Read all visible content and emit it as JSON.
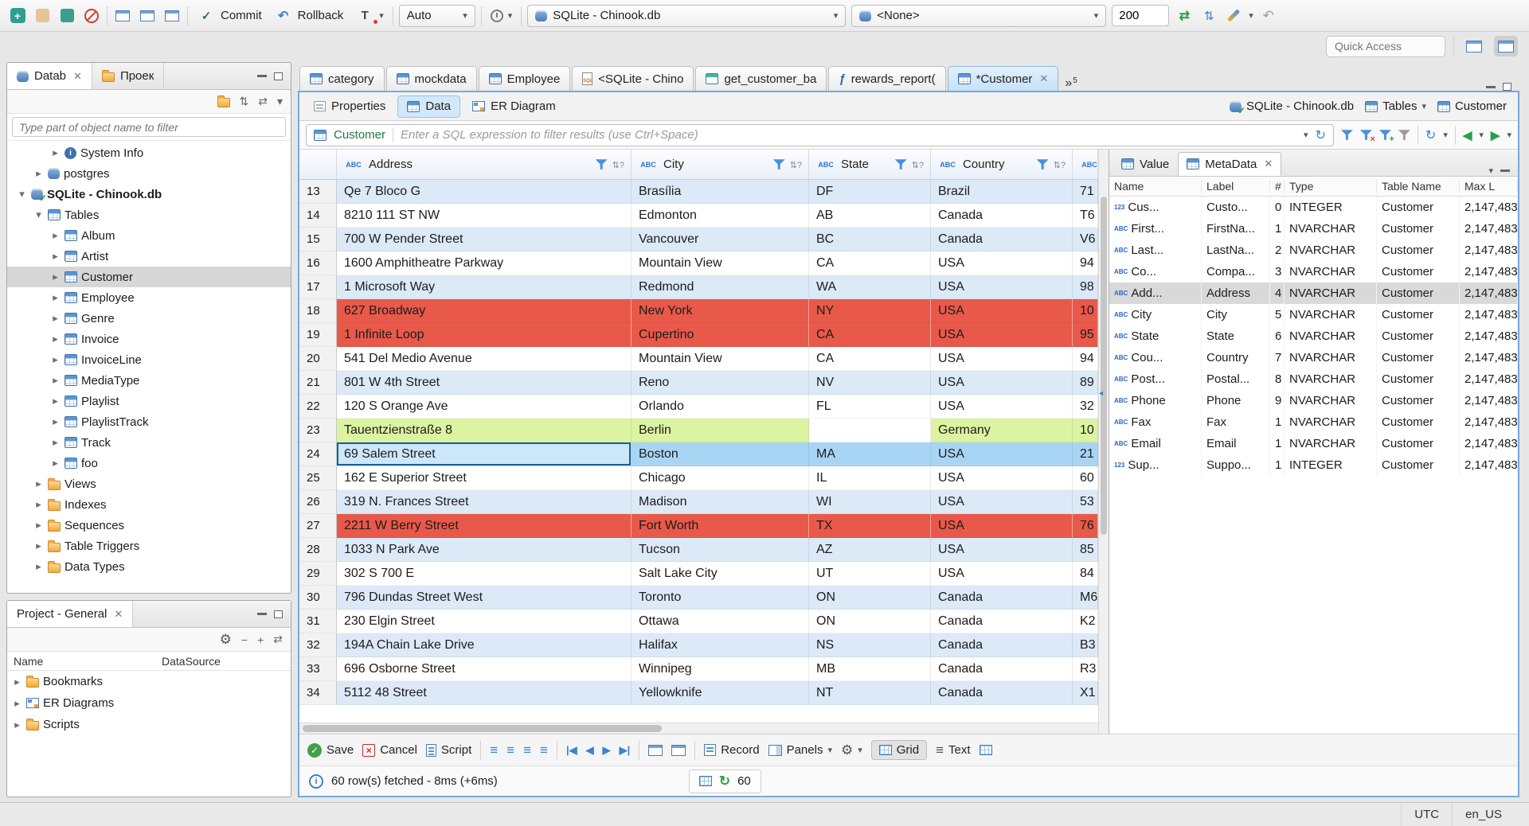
{
  "toolbar": {
    "commit_label": "Commit",
    "rollback_label": "Rollback",
    "auto_label": "Auto",
    "connection": "SQLite - Chinook.db",
    "schema": "<None>",
    "fetch_size": "200",
    "quick_access_placeholder": "Quick Access"
  },
  "navigator": {
    "tab_database": "Datab",
    "tab_project": "Проек",
    "filter_placeholder": "Type part of object name to filter",
    "tree": [
      {
        "label": "System Info",
        "depth": 2,
        "state": "collapsed",
        "icon": "info"
      },
      {
        "label": "postgres",
        "depth": 1,
        "state": "collapsed",
        "icon": "db"
      },
      {
        "label": "SQLite - Chinook.db",
        "depth": 0,
        "state": "expanded",
        "icon": "dbcheck",
        "bold": "bold"
      },
      {
        "label": "Tables",
        "depth": 1,
        "state": "expanded",
        "icon": "table"
      },
      {
        "label": "Album",
        "depth": 2,
        "state": "collapsed",
        "icon": "table"
      },
      {
        "label": "Artist",
        "depth": 2,
        "state": "collapsed",
        "icon": "table"
      },
      {
        "label": "Customer",
        "depth": 2,
        "state": "collapsed",
        "icon": "table",
        "sel": "sel"
      },
      {
        "label": "Employee",
        "depth": 2,
        "state": "collapsed",
        "icon": "table"
      },
      {
        "label": "Genre",
        "depth": 2,
        "state": "collapsed",
        "icon": "table"
      },
      {
        "label": "Invoice",
        "depth": 2,
        "state": "collapsed",
        "icon": "table"
      },
      {
        "label": "InvoiceLine",
        "depth": 2,
        "state": "collapsed",
        "icon": "table"
      },
      {
        "label": "MediaType",
        "depth": 2,
        "state": "collapsed",
        "icon": "table"
      },
      {
        "label": "Playlist",
        "depth": 2,
        "state": "collapsed",
        "icon": "table"
      },
      {
        "label": "PlaylistTrack",
        "depth": 2,
        "state": "collapsed",
        "icon": "table"
      },
      {
        "label": "Track",
        "depth": 2,
        "state": "collapsed",
        "icon": "table"
      },
      {
        "label": "foo",
        "depth": 2,
        "state": "collapsed",
        "icon": "table"
      },
      {
        "label": "Views",
        "depth": 1,
        "state": "collapsed",
        "icon": "folder"
      },
      {
        "label": "Indexes",
        "depth": 1,
        "state": "collapsed",
        "icon": "folder"
      },
      {
        "label": "Sequences",
        "depth": 1,
        "state": "collapsed",
        "icon": "folder"
      },
      {
        "label": "Table Triggers",
        "depth": 1,
        "state": "collapsed",
        "icon": "folder"
      },
      {
        "label": "Data Types",
        "depth": 1,
        "state": "collapsed",
        "icon": "folder"
      }
    ]
  },
  "project_panel": {
    "title": "Project - General",
    "col_name": "Name",
    "col_datasource": "DataSource",
    "items": [
      {
        "label": "Bookmarks",
        "icon": "folder",
        "state": "collapsed"
      },
      {
        "label": "ER Diagrams",
        "icon": "diag",
        "state": "collapsed"
      },
      {
        "label": "Scripts",
        "icon": "folder",
        "state": "collapsed"
      }
    ]
  },
  "editor_tabs": [
    {
      "label": "category",
      "icon": "table"
    },
    {
      "label": "mockdata",
      "icon": "table"
    },
    {
      "label": "Employee",
      "icon": "table"
    },
    {
      "label": "<SQLite - Chino",
      "icon": "sql"
    },
    {
      "label": "get_customer_ba",
      "icon": "view"
    },
    {
      "label": "rewards_report(",
      "icon": "func"
    },
    {
      "label": "*Customer",
      "icon": "table",
      "active": "active",
      "closable": "yes"
    }
  ],
  "tab_overflow_count": "5",
  "result_tabs": {
    "properties": "Properties",
    "data": "Data",
    "er_diagram": "ER Diagram"
  },
  "breadcrumb": {
    "connection": "SQLite - Chinook.db",
    "container": "Tables",
    "entity": "Customer"
  },
  "filter": {
    "table": "Customer",
    "placeholder": "Enter a SQL expression to filter results (use Ctrl+Space)"
  },
  "grid": {
    "columns": [
      "Address",
      "City",
      "State",
      "Country"
    ],
    "rows": [
      {
        "num": "13",
        "address": "Qe 7 Bloco G",
        "city": "Brasília",
        "state": "DF",
        "country": "Brazil",
        "extra": "71",
        "hl": "blue"
      },
      {
        "num": "14",
        "address": "8210 111 ST NW",
        "city": "Edmonton",
        "state": "AB",
        "country": "Canada",
        "extra": "T6",
        "hl": "white"
      },
      {
        "num": "15",
        "address": "700 W Pender Street",
        "city": "Vancouver",
        "state": "BC",
        "country": "Canada",
        "extra": "V6",
        "hl": "blue"
      },
      {
        "num": "16",
        "address": "1600 Amphitheatre Parkway",
        "city": "Mountain View",
        "state": "CA",
        "country": "USA",
        "extra": "94",
        "hl": "white"
      },
      {
        "num": "17",
        "address": "1 Microsoft Way",
        "city": "Redmond",
        "state": "WA",
        "country": "USA",
        "extra": "98",
        "hl": "blue"
      },
      {
        "num": "18",
        "address": "627 Broadway",
        "city": "New York",
        "state": "NY",
        "country": "USA",
        "extra": "10",
        "hl": "red"
      },
      {
        "num": "19",
        "address": "1 Infinite Loop",
        "city": "Cupertino",
        "state": "CA",
        "country": "USA",
        "extra": "95",
        "hl": "red"
      },
      {
        "num": "20",
        "address": "541 Del Medio Avenue",
        "city": "Mountain View",
        "state": "CA",
        "country": "USA",
        "extra": "94",
        "hl": "white"
      },
      {
        "num": "21",
        "address": "801 W 4th Street",
        "city": "Reno",
        "state": "NV",
        "country": "USA",
        "extra": "89",
        "hl": "blue"
      },
      {
        "num": "22",
        "address": "120 S Orange Ave",
        "city": "Orlando",
        "state": "FL",
        "country": "USA",
        "extra": "32",
        "hl": "white"
      },
      {
        "num": "23",
        "address": "Tauentzienstraße 8",
        "city": "Berlin",
        "state": "",
        "country": "Germany",
        "extra": "10",
        "hl": "green"
      },
      {
        "num": "24",
        "address": "69 Salem Street",
        "city": "Boston",
        "state": "MA",
        "country": "USA",
        "extra": "21",
        "hl": "selected"
      },
      {
        "num": "25",
        "address": "162 E Superior Street",
        "city": "Chicago",
        "state": "IL",
        "country": "USA",
        "extra": "60",
        "hl": "white"
      },
      {
        "num": "26",
        "address": "319 N. Frances Street",
        "city": "Madison",
        "state": "WI",
        "country": "USA",
        "extra": "53",
        "hl": "blue"
      },
      {
        "num": "27",
        "address": "2211 W Berry Street",
        "city": "Fort Worth",
        "state": "TX",
        "country": "USA",
        "extra": "76",
        "hl": "red"
      },
      {
        "num": "28",
        "address": "1033 N Park Ave",
        "city": "Tucson",
        "state": "AZ",
        "country": "USA",
        "extra": "85",
        "hl": "blue"
      },
      {
        "num": "29",
        "address": "302 S 700 E",
        "city": "Salt Lake City",
        "state": "UT",
        "country": "USA",
        "extra": "84",
        "hl": "white"
      },
      {
        "num": "30",
        "address": "796 Dundas Street West",
        "city": "Toronto",
        "state": "ON",
        "country": "Canada",
        "extra": "M6",
        "hl": "blue"
      },
      {
        "num": "31",
        "address": "230 Elgin Street",
        "city": "Ottawa",
        "state": "ON",
        "country": "Canada",
        "extra": "K2",
        "hl": "white"
      },
      {
        "num": "32",
        "address": "194A Chain Lake Drive",
        "city": "Halifax",
        "state": "NS",
        "country": "Canada",
        "extra": "B3",
        "hl": "blue"
      },
      {
        "num": "33",
        "address": "696 Osborne Street",
        "city": "Winnipeg",
        "state": "MB",
        "country": "Canada",
        "extra": "R3",
        "hl": "white"
      },
      {
        "num": "34",
        "address": "5112 48 Street",
        "city": "Yellowknife",
        "state": "NT",
        "country": "Canada",
        "extra": "X1",
        "hl": "blue"
      }
    ]
  },
  "meta_panel": {
    "tab_value": "Value",
    "tab_metadata": "MetaData",
    "columns": [
      "Name",
      "Label",
      "#",
      "Type",
      "Table Name",
      "Max L"
    ],
    "rows": [
      {
        "icon": "123",
        "name": "Cus...",
        "label": "Custo...",
        "num": "0",
        "type": "INTEGER",
        "table": "Customer",
        "max": "2,147,483"
      },
      {
        "icon": "abc",
        "name": "First...",
        "label": "FirstNa...",
        "num": "1",
        "type": "NVARCHAR",
        "table": "Customer",
        "max": "2,147,483"
      },
      {
        "icon": "abc",
        "name": "Last...",
        "label": "LastNa...",
        "num": "2",
        "type": "NVARCHAR",
        "table": "Customer",
        "max": "2,147,483"
      },
      {
        "icon": "abc",
        "name": "Co...",
        "label": "Compa...",
        "num": "3",
        "type": "NVARCHAR",
        "table": "Customer",
        "max": "2,147,483"
      },
      {
        "icon": "abc",
        "name": "Add...",
        "label": "Address",
        "num": "4",
        "type": "NVARCHAR",
        "table": "Customer",
        "max": "2,147,483",
        "sel": "sel"
      },
      {
        "icon": "abc",
        "name": "City",
        "label": "City",
        "num": "5",
        "type": "NVARCHAR",
        "table": "Customer",
        "max": "2,147,483"
      },
      {
        "icon": "abc",
        "name": "State",
        "label": "State",
        "num": "6",
        "type": "NVARCHAR",
        "table": "Customer",
        "max": "2,147,483"
      },
      {
        "icon": "abc",
        "name": "Cou...",
        "label": "Country",
        "num": "7",
        "type": "NVARCHAR",
        "table": "Customer",
        "max": "2,147,483"
      },
      {
        "icon": "abc",
        "name": "Post...",
        "label": "Postal...",
        "num": "8",
        "type": "NVARCHAR",
        "table": "Customer",
        "max": "2,147,483"
      },
      {
        "icon": "abc",
        "name": "Phone",
        "label": "Phone",
        "num": "9",
        "type": "NVARCHAR",
        "table": "Customer",
        "max": "2,147,483"
      },
      {
        "icon": "abc",
        "name": "Fax",
        "label": "Fax",
        "num": "1",
        "type": "NVARCHAR",
        "table": "Customer",
        "max": "2,147,483"
      },
      {
        "icon": "abc",
        "name": "Email",
        "label": "Email",
        "num": "1",
        "type": "NVARCHAR",
        "table": "Customer",
        "max": "2,147,483"
      },
      {
        "icon": "123",
        "name": "Sup...",
        "label": "Suppo...",
        "num": "1",
        "type": "INTEGER",
        "table": "Customer",
        "max": "2,147,483"
      }
    ]
  },
  "bottom_toolbar": {
    "save": "Save",
    "cancel": "Cancel",
    "script": "Script",
    "record": "Record",
    "panels": "Panels",
    "grid": "Grid",
    "text": "Text"
  },
  "result_status": {
    "message": "60 row(s) fetched - 8ms (+6ms)",
    "auto_refresh_count": "60"
  },
  "status_bar": {
    "timezone": "UTC",
    "locale": "en_US"
  }
}
